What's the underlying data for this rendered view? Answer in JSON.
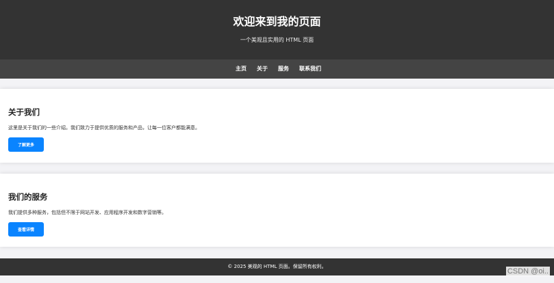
{
  "header": {
    "title": "欢迎来到我的页面",
    "subtitle": "一个美观且实用的 HTML 页面"
  },
  "nav": {
    "items": [
      {
        "label": "主页"
      },
      {
        "label": "关于"
      },
      {
        "label": "服务"
      },
      {
        "label": "联系我们"
      }
    ]
  },
  "sections": {
    "about": {
      "title": "关于我们",
      "text": "这里是关于我们的一些介绍。我们致力于提供优质的服务和产品，让每一位客户都能满意。",
      "button_label": "了解更多"
    },
    "services": {
      "title": "我们的服务",
      "text": "我们提供多种服务，包括但不限于网站开发、应用程序开发和数字营销等。",
      "button_label": "查看详情"
    }
  },
  "footer": {
    "text": "© 2025 美观的 HTML 页面。保留所有权利。"
  },
  "watermark": {
    "text": "CSDN @oi.."
  },
  "colors": {
    "header_bg": "#333333",
    "nav_bg": "#444444",
    "button_bg": "#0a84ff",
    "page_bg": "#f3f3f6"
  }
}
